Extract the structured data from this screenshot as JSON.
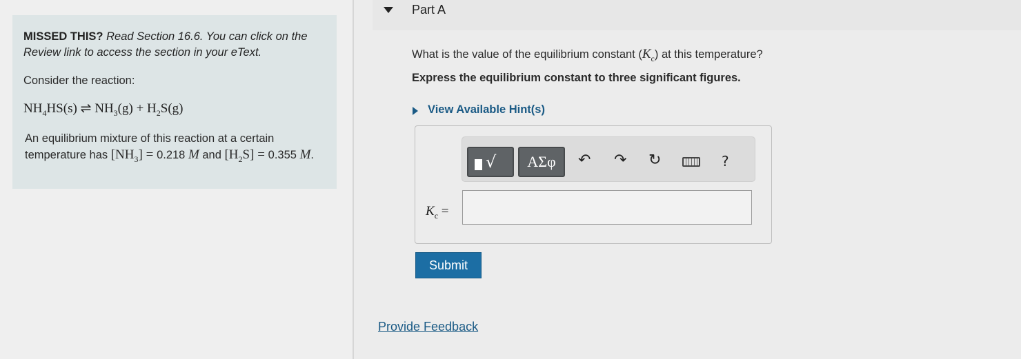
{
  "sidebar": {
    "missed_lead": "MISSED THIS?",
    "missed_text": "Read Section 16.6. You can click on the Review link to access the section in your eText.",
    "consider": "Consider the reaction:",
    "reaction": {
      "reactant": "NH",
      "reactant_sub1": "4",
      "reactant_rest": "HS(s)",
      "arrow": "⇌",
      "product1": "NH",
      "product1_sub": "3",
      "product1_state": "(g)",
      "plus": "+",
      "product2": "H",
      "product2_sub": "2",
      "product2_rest": "S(g)"
    },
    "equil": {
      "line_a": "An equilibrium mixture of this reaction at a certain temperature has ",
      "nh3_open": "[NH",
      "nh3_sub": "3",
      "nh3_close": "]",
      "eq1": " = ",
      "nh3_value": "0.218",
      "unit": "M",
      "and": " and ",
      "h2s_open": "[H",
      "h2s_sub": "2",
      "h2s_close": "S]",
      "eq2": " = ",
      "h2s_value": "0.355",
      "unit2": "M",
      "period": "."
    }
  },
  "part": {
    "title": "Part A",
    "question_pre": "What is the value of the equilibrium constant (",
    "question_k": "K",
    "question_sub": "c",
    "question_post": ") at this temperature?",
    "express": "Express the equilibrium constant to three significant figures.",
    "hint": "View Available Hint(s)"
  },
  "toolbar": {
    "greek_label": "ΑΣφ",
    "radical_glyph": "√",
    "undo_glyph": "↶",
    "redo_glyph": "↷",
    "reset_glyph": "↻",
    "help_glyph": "?",
    "icons": [
      "templates-icon",
      "greek-icon",
      "undo-icon",
      "redo-icon",
      "reset-icon",
      "keyboard-icon",
      "help-icon"
    ]
  },
  "answer": {
    "label_k": "K",
    "label_sub": "c",
    "label_eq": " =",
    "value": ""
  },
  "submit_label": "Submit",
  "feedback_label": "Provide Feedback",
  "colors": {
    "link": "#1a5a85",
    "submit": "#1c6ea4",
    "info_box": "#dde5e6"
  }
}
